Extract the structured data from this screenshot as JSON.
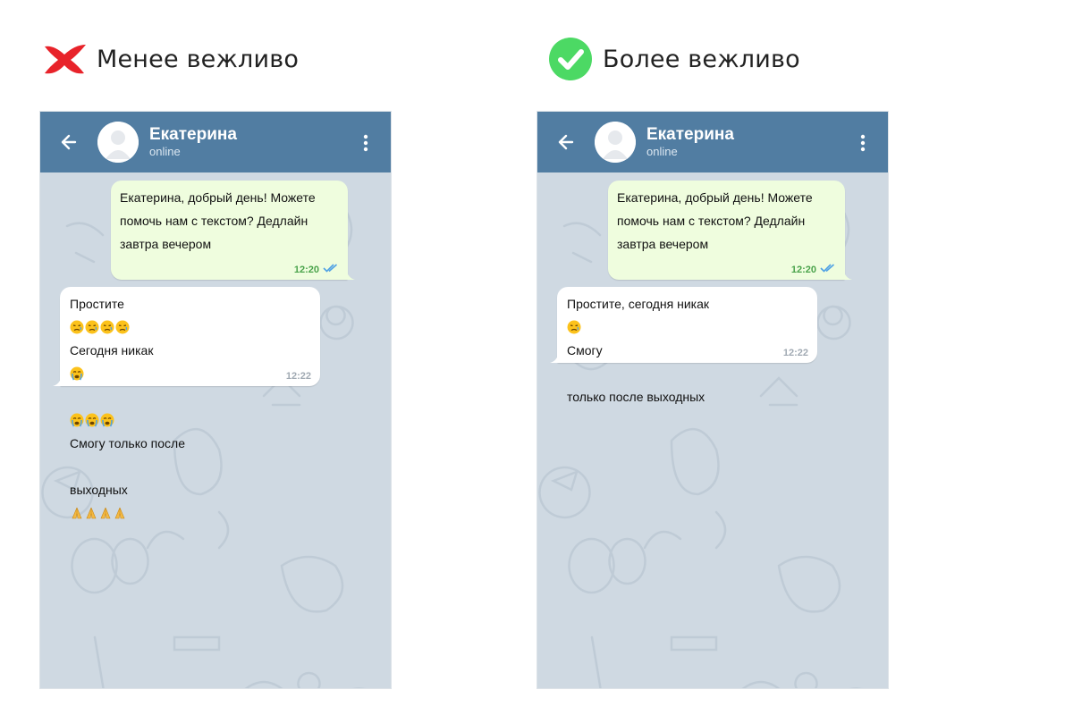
{
  "panels": {
    "bad": {
      "heading": "Менее вежливо",
      "mark_icon": "red-cross-icon",
      "contact": {
        "name": "Екатерина",
        "status": "online"
      },
      "outgoing": {
        "text": "Екатерина, добрый день! Можете\nпомочь нам с текстом? Дедлайн\nзавтра вечером",
        "time": "12:20"
      },
      "incoming": {
        "part1": "Простите",
        "part2": "Сегодня никак",
        "part3": "Смогу только после",
        "part4": "выходных",
        "time": "12:22"
      }
    },
    "good": {
      "heading": "Более вежливо",
      "mark_icon": "green-check-icon",
      "contact": {
        "name": "Екатерина",
        "status": "online"
      },
      "outgoing": {
        "text": "Екатерина, добрый день! Можете\nпомочь нам с текстом? Дедлайн\nзавтра вечером",
        "time": "12:20"
      },
      "incoming": {
        "part1": "Простите, сегодня никак",
        "part2": "Смогу",
        "part3": "только после выходных",
        "time": "12:22"
      }
    }
  },
  "colors": {
    "header": "#517da2",
    "outgoing_bubble": "#effdde",
    "incoming_bubble": "#ffffff",
    "wallpaper": "#cfd9e2",
    "cross": "#e8232a",
    "check": "#4cd964"
  }
}
